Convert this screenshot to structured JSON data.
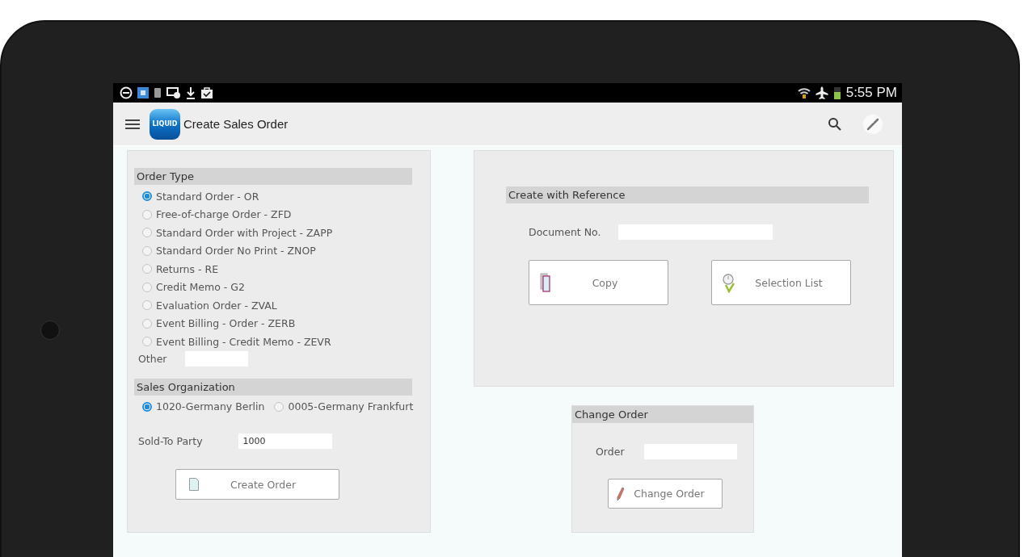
{
  "status_bar": {
    "time": "5:55 PM"
  },
  "app_bar": {
    "logo_text": "LIQUID",
    "title": "Create Sales Order"
  },
  "order_type": {
    "heading": "Order Type",
    "options": [
      {
        "label": "Standard Order - OR",
        "selected": true
      },
      {
        "label": "Free-of-charge Order - ZFD",
        "selected": false
      },
      {
        "label": "Standard Order with Project - ZAPP",
        "selected": false
      },
      {
        "label": "Standard Order No Print - ZNOP",
        "selected": false
      },
      {
        "label": "Returns - RE",
        "selected": false
      },
      {
        "label": "Credit Memo - G2",
        "selected": false
      },
      {
        "label": "Evaluation Order - ZVAL",
        "selected": false
      },
      {
        "label": "Event Billing - Order - ZERB",
        "selected": false
      },
      {
        "label": "Event Billing - Credit Memo - ZEVR",
        "selected": false
      }
    ],
    "other_label": "Other"
  },
  "sales_organization": {
    "heading": "Sales Organization",
    "options": [
      {
        "label": "1020-Germany Berlin",
        "selected": true
      },
      {
        "label": "0005-Germany Frankfurt",
        "selected": false
      }
    ],
    "sold_to_label": "Sold-To Party",
    "sold_to_value": "1000",
    "button": "Create Order"
  },
  "create_with_reference": {
    "heading": "Create with Reference",
    "document_label": "Document No.",
    "buttons": [
      {
        "kind": "copy",
        "label": "Copy"
      },
      {
        "kind": "selection",
        "label": "Selection List"
      }
    ]
  },
  "change_order": {
    "heading": "Change Order",
    "order_label": "Order",
    "button": "Change Order"
  }
}
